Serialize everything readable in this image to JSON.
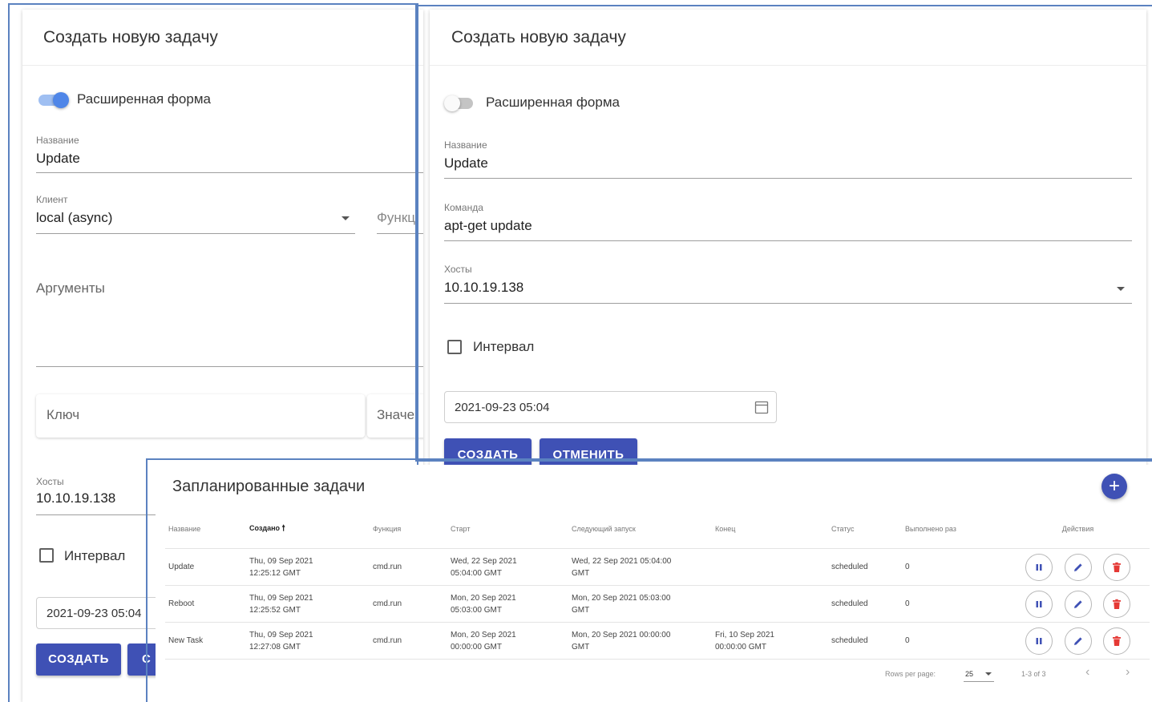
{
  "left_form": {
    "title": "Создать новую задачу",
    "advanced_toggle": {
      "label": "Расширенная форма",
      "on": true
    },
    "name": {
      "label": "Название",
      "value": "Update"
    },
    "client": {
      "label": "Клиент",
      "value": "local (async)"
    },
    "function_label": "Функц",
    "arguments_label": "Аргументы",
    "key_placeholder": "Ключ",
    "value_placeholder": "Значе",
    "hosts": {
      "label": "Хосты",
      "value": "10.10.19.138"
    },
    "interval_label": "Интервал",
    "date_value": "2021-09-23 05:04",
    "create_button": "СОЗДАТЬ",
    "cancel_button_partial": "С"
  },
  "right_form": {
    "title": "Создать новую задачу",
    "advanced_toggle": {
      "label": "Расширенная форма",
      "on": false
    },
    "name": {
      "label": "Название",
      "value": "Update"
    },
    "command": {
      "label": "Команда",
      "value": "apt-get update"
    },
    "hosts": {
      "label": "Хосты",
      "value": "10.10.19.138"
    },
    "interval_label": "Интервал",
    "date_value": "2021-09-23 05:04",
    "create_button": "СОЗДАТЬ",
    "cancel_button": "ОТМЕНИТЬ"
  },
  "scheduled": {
    "title": "Запланированные задачи",
    "headers": {
      "name": "Название",
      "created": "Создано",
      "function": "Функция",
      "start": "Старт",
      "next_run": "Следующий запуск",
      "end": "Конец",
      "status": "Статус",
      "runs": "Выполнено раз",
      "actions": "Действия"
    },
    "rows": [
      {
        "name": "Update",
        "created_1": "Thu, 09 Sep 2021",
        "created_2": "12:25:12 GMT",
        "function": "cmd.run",
        "start_1": "Wed, 22 Sep 2021",
        "start_2": "05:04:00 GMT",
        "next_1": "Wed, 22 Sep 2021 05:04:00",
        "next_2": "GMT",
        "end_1": "",
        "end_2": "",
        "status": "scheduled",
        "runs": "0"
      },
      {
        "name": "Reboot",
        "created_1": "Thu, 09 Sep 2021",
        "created_2": "12:25:52 GMT",
        "function": "cmd.run",
        "start_1": "Mon, 20 Sep 2021",
        "start_2": "05:03:00 GMT",
        "next_1": "Mon, 20 Sep 2021 05:03:00",
        "next_2": "GMT",
        "end_1": "",
        "end_2": "",
        "status": "scheduled",
        "runs": "0"
      },
      {
        "name": "New Task",
        "created_1": "Thu, 09 Sep 2021",
        "created_2": "12:27:08 GMT",
        "function": "cmd.run",
        "start_1": "Mon, 20 Sep 2021",
        "start_2": "00:00:00 GMT",
        "next_1": "Mon, 20 Sep 2021 00:00:00",
        "next_2": "GMT",
        "end_1": "Fri, 10 Sep 2021",
        "end_2": "00:00:00 GMT",
        "status": "scheduled",
        "runs": "0"
      }
    ],
    "pagination": {
      "rows_per_page_label": "Rows per page:",
      "rows_per_page": "25",
      "range": "1-3 of 3"
    }
  },
  "icons": {
    "add": "plus-icon",
    "pause": "pause-icon",
    "edit": "pencil-icon",
    "delete": "trash-icon",
    "calendar": "calendar-icon",
    "sort": "arrow-up-icon"
  },
  "colors": {
    "primary": "#3f51b5",
    "toggle_on": "#4f86e8",
    "delete": "#e53935",
    "frame": "#5b82c0"
  }
}
